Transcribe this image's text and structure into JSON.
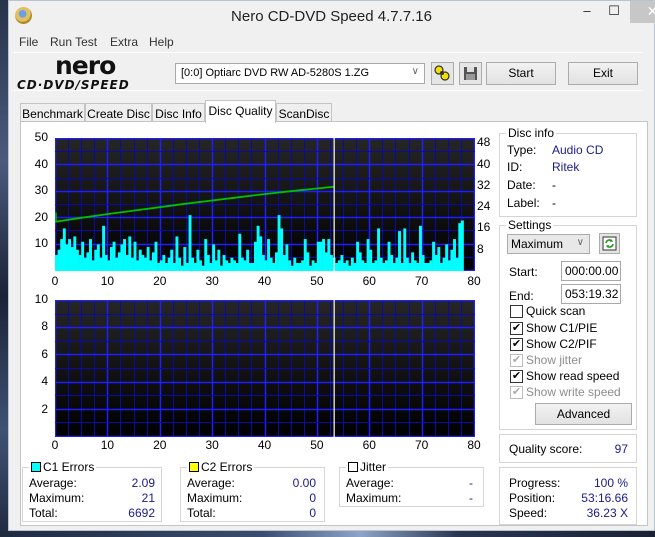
{
  "window": {
    "title": "Nero CD-DVD Speed 4.7.7.16",
    "min_glyph": "–",
    "max_glyph": "☐",
    "close_glyph": "✕"
  },
  "menu": [
    "File",
    "Run Test",
    "Extra",
    "Help"
  ],
  "logo": {
    "line1": "nero",
    "line2": "CD·DVD∕SPEED"
  },
  "toolbar": {
    "drive": "[0:0]  Optiarc DVD RW AD-5280S 1.ZG",
    "drive_chevron": "∨",
    "start_label": "Start",
    "exit_label": "Exit"
  },
  "tabs": [
    {
      "label": "Benchmark",
      "active": false
    },
    {
      "label": "Create Disc",
      "active": false
    },
    {
      "label": "Disc Info",
      "active": false
    },
    {
      "label": "Disc Quality",
      "active": true
    },
    {
      "label": "ScanDisc",
      "active": false
    }
  ],
  "disc_info": {
    "title": "Disc info",
    "type_label": "Type:",
    "type_value": "Audio CD",
    "id_label": "ID:",
    "id_value": "Ritek",
    "date_label": "Date:",
    "date_value": "-",
    "label_label": "Label:",
    "label_value": "-"
  },
  "settings": {
    "title": "Settings",
    "speed": "Maximum",
    "start_label": "Start:",
    "start_value": "000:00.00",
    "end_label": "End:",
    "end_value": "053:19.32",
    "checkboxes": [
      {
        "label": "Quick scan",
        "checked": false,
        "enabled": true
      },
      {
        "label": "Show C1/PIE",
        "checked": true,
        "enabled": true
      },
      {
        "label": "Show C2/PIF",
        "checked": true,
        "enabled": true
      },
      {
        "label": "Show jitter",
        "checked": true,
        "enabled": false
      },
      {
        "label": "Show read speed",
        "checked": true,
        "enabled": true
      },
      {
        "label": "Show write speed",
        "checked": true,
        "enabled": false
      }
    ],
    "advanced_label": "Advanced"
  },
  "quality": {
    "label": "Quality score:",
    "value": "97"
  },
  "progress": {
    "progress_label": "Progress:",
    "progress_value": "100 %",
    "position_label": "Position:",
    "position_value": "53:16.66",
    "speed_label": "Speed:",
    "speed_value": "36.23 X"
  },
  "c1": {
    "title": "C1 Errors",
    "color": "#00ffff",
    "average_label": "Average:",
    "average": "2.09",
    "maximum_label": "Maximum:",
    "maximum": "21",
    "total_label": "Total:",
    "total": "6692"
  },
  "c2": {
    "title": "C2 Errors",
    "color": "#ffff00",
    "average_label": "Average:",
    "average": "0.00",
    "maximum_label": "Maximum:",
    "maximum": "0",
    "total_label": "Total:",
    "total": "0"
  },
  "jitter": {
    "title": "Jitter",
    "color": "#ffffff",
    "average_label": "Average:",
    "average": "-",
    "maximum_label": "Maximum:",
    "maximum": "-"
  },
  "colors": {
    "grid": "#0000ff",
    "c1_bars": "#00ffff",
    "read_speed": "#00c000",
    "end_marker": "#ffffff"
  },
  "chart_data": [
    {
      "type": "bar",
      "title": "C1 Errors / Read speed",
      "xlabel": "Time (min)",
      "ylabel": "C1 errors",
      "y2label": "Read speed (X)",
      "xlim": [
        0,
        80
      ],
      "ylim": [
        0,
        50
      ],
      "y2lim": [
        0,
        50
      ],
      "x_ticks": [
        "0",
        "10",
        "20",
        "30",
        "40",
        "50",
        "60",
        "70",
        "80"
      ],
      "y_ticks": [
        "10",
        "20",
        "30",
        "40",
        "50"
      ],
      "y2_ticks": [
        "8",
        "16",
        "24",
        "32",
        "40",
        "48"
      ],
      "grid": true,
      "end_marker_x": 53.3,
      "series": [
        {
          "name": "C1 Errors",
          "type": "bar",
          "x_step": 0.5,
          "values": [
            6,
            8,
            12,
            16,
            10,
            12,
            9,
            13,
            8,
            6,
            11,
            5,
            7,
            12,
            4,
            8,
            10,
            5,
            17,
            6,
            4,
            9,
            11,
            5,
            7,
            10,
            12,
            6,
            13,
            5,
            11,
            4,
            8,
            6,
            5,
            9,
            4,
            7,
            11,
            3,
            4,
            6,
            3,
            5,
            8,
            3,
            13,
            5,
            2,
            9,
            3,
            21,
            5,
            3,
            8,
            4,
            2,
            12,
            6,
            3,
            10,
            4,
            8,
            2,
            6,
            4,
            3,
            5,
            4,
            3,
            14,
            5,
            4,
            8,
            3,
            3,
            11,
            17,
            13,
            6,
            4,
            12,
            5,
            3,
            7,
            21,
            16,
            6,
            10,
            4,
            2,
            5,
            3,
            3,
            4,
            12,
            7,
            2,
            4,
            3,
            11,
            11,
            12,
            7,
            12,
            6,
            5,
            3,
            4,
            6,
            3,
            4,
            2,
            5,
            3,
            11,
            7,
            4,
            3,
            12,
            8,
            3,
            4,
            16,
            5,
            3,
            4,
            11,
            6,
            3,
            5,
            15,
            3,
            16,
            5,
            3,
            7,
            4,
            3,
            17,
            6,
            3,
            3,
            4,
            11,
            6,
            9,
            3,
            5,
            10,
            4,
            8,
            12,
            5,
            18,
            19
          ]
        },
        {
          "name": "Read speed",
          "type": "line",
          "points": [
            [
              0,
              18.5
            ],
            [
              5,
              20.0
            ],
            [
              10,
              21.4
            ],
            [
              15,
              22.7
            ],
            [
              20,
              24.0
            ],
            [
              25,
              25.3
            ],
            [
              30,
              26.5
            ],
            [
              35,
              27.7
            ],
            [
              40,
              28.9
            ],
            [
              45,
              30.0
            ],
            [
              50,
              31.0
            ],
            [
              53.3,
              31.7
            ]
          ]
        }
      ]
    },
    {
      "type": "bar",
      "title": "C2 Errors",
      "xlabel": "Time (min)",
      "ylabel": "C2 errors",
      "xlim": [
        0,
        80
      ],
      "ylim": [
        0,
        10
      ],
      "x_ticks": [
        "0",
        "10",
        "20",
        "30",
        "40",
        "50",
        "60",
        "70",
        "80"
      ],
      "y_ticks": [
        "2",
        "4",
        "6",
        "8",
        "10"
      ],
      "grid": true,
      "end_marker_x": 53.3,
      "series": [
        {
          "name": "C2 Errors",
          "values": []
        }
      ]
    }
  ]
}
